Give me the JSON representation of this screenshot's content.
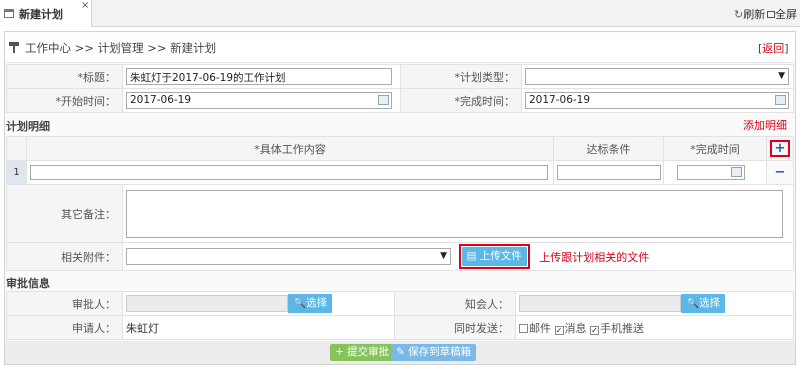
{
  "tab": {
    "title": "新建计划",
    "close": "×"
  },
  "toolbar": {
    "refresh": "刷新",
    "fullscreen": "全屏"
  },
  "breadcrumb": {
    "text": "工作中心 >> 计划管理 >> 新建计划",
    "back_open": "[",
    "back": "返回",
    "back_close": "]"
  },
  "form": {
    "title_label": "*标题：",
    "title_value": "朱虹灯于2017-06-19的工作计划",
    "type_label": "*计划类型：",
    "type_value": "",
    "start_label": "*开始时间：",
    "start_value": "2017-06-19",
    "end_label": "*完成时间：",
    "end_value": "2017-06-19"
  },
  "details": {
    "section": "计划明细",
    "add_label": "添加明细",
    "add_icon": "+",
    "headers": [
      "*具体工作内容",
      "达标条件",
      "*完成时间"
    ],
    "rows": [
      {
        "index": "1",
        "content": "",
        "standard": "",
        "due": ""
      }
    ],
    "remove_icon": "−"
  },
  "extra": {
    "remark_label": "其它备注：",
    "attach_label": "相关附件：",
    "upload_label": "上传文件",
    "upload_hint": "上传跟计划相关的文件"
  },
  "approval": {
    "section": "审批信息",
    "approver_label": "审批人：",
    "select_label": "选择",
    "cc_label": "知会人：",
    "cc_select_label": "选择",
    "applicant_label": "申请人：",
    "applicant_value": "朱虹灯",
    "notify_label": "同时发送：",
    "notify_options": [
      {
        "label": "邮件",
        "checked": false
      },
      {
        "label": "消息",
        "checked": true
      },
      {
        "label": "手机推送",
        "checked": true
      }
    ]
  },
  "actions": {
    "submit": "提交审批",
    "draft": "保存到草稿箱"
  },
  "colors": {
    "accent_red": "#d9001b",
    "button_blue": "#5bb7e8",
    "button_green": "#86c45b"
  }
}
